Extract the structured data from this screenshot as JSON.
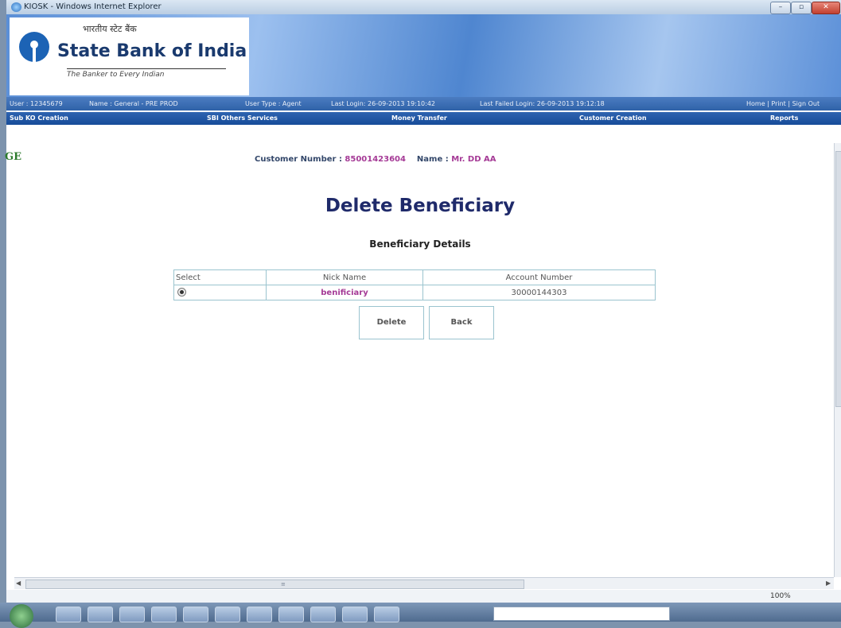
{
  "window": {
    "title": "KIOSK - Windows Internet Explorer",
    "min_glyph": "–",
    "max_glyph": "▫",
    "close_glyph": "✕"
  },
  "banner": {
    "hindi_name": "भारतीय स्टेट बैंक",
    "bank_name": "State Bank of India",
    "tagline": "The Banker to Every Indian"
  },
  "infobar": {
    "user": "User : 12345679",
    "name": "Name : General - PRE PROD",
    "user_type": "User Type : Agent",
    "last_login": "Last Login: 26-09-2013 19:10:42",
    "last_failed": "Last Failed Login: 26-09-2013 19:12:18",
    "links": "Home  |  Print  |  Sign Out"
  },
  "menu": {
    "items": [
      "Sub KO Creation",
      "SBI Others Services",
      "Money Transfer",
      "Customer Creation",
      "Reports"
    ]
  },
  "content": {
    "left_fragment": "GE",
    "customer_number_label": "Customer Number : ",
    "customer_number": "85001423604",
    "name_label": "Name : ",
    "name_value": "Mr. DD AA",
    "heading": "Delete Beneficiary",
    "subheading": "Beneficiary Details"
  },
  "table": {
    "headers": [
      "Select",
      "Nick Name",
      "Account Number"
    ],
    "rows": [
      {
        "selected": true,
        "nick_name": "benificiary",
        "account_number": "30000144303"
      }
    ]
  },
  "buttons": {
    "delete": "Delete",
    "back": "Back"
  },
  "status": {
    "zoom": "100%"
  }
}
